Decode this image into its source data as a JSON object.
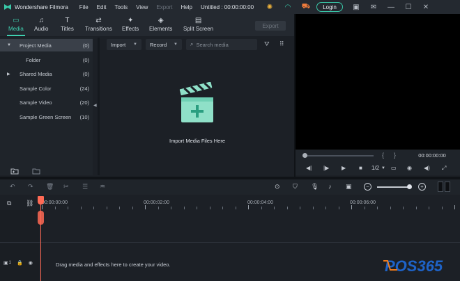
{
  "app": {
    "name": "Wondershare Filmora",
    "project_title": "Untitled : 00:00:00:00",
    "login_label": "Login"
  },
  "menu": [
    "File",
    "Edit",
    "Tools",
    "View",
    "Export",
    "Help"
  ],
  "tabs": [
    {
      "label": "Media",
      "icon": "folder-icon",
      "active": true
    },
    {
      "label": "Audio",
      "icon": "music-note-icon",
      "active": false
    },
    {
      "label": "Titles",
      "icon": "text-icon",
      "active": false
    },
    {
      "label": "Transitions",
      "icon": "transition-icon",
      "active": false
    },
    {
      "label": "Effects",
      "icon": "effects-icon",
      "active": false
    },
    {
      "label": "Elements",
      "icon": "elements-icon",
      "active": false
    },
    {
      "label": "Split Screen",
      "icon": "split-screen-icon",
      "active": false
    }
  ],
  "export_label": "Export",
  "library": [
    {
      "label": "Project Media",
      "count": "(0)",
      "selected": true,
      "expanded": true,
      "indent": 0
    },
    {
      "label": "Folder",
      "count": "(0)",
      "selected": false,
      "indent": 1
    },
    {
      "label": "Shared Media",
      "count": "(0)",
      "selected": false,
      "collapsed": true,
      "indent": 0
    },
    {
      "label": "Sample Color",
      "count": "(24)",
      "selected": false,
      "indent": 0
    },
    {
      "label": "Sample Video",
      "count": "(20)",
      "selected": false,
      "indent": 0
    },
    {
      "label": "Sample Green Screen",
      "count": "(10)",
      "selected": false,
      "indent": 0
    }
  ],
  "media": {
    "import_dropdown": "Import",
    "record_dropdown": "Record",
    "search_placeholder": "Search media",
    "import_hint": "Import Media Files Here"
  },
  "preview": {
    "timecode": "00:00:00:00",
    "playback_speed": "1/2"
  },
  "timeline": {
    "ruler_labels": [
      "00:00:00:00",
      "00:00:02:00",
      "00:00:04:00",
      "00:00:06:00"
    ],
    "drag_hint": "Drag media and effects here to create your video.",
    "track_number": "1"
  },
  "watermark": "POS365",
  "colors": {
    "accent": "#3fd0b0",
    "playhead": "#ff6a55",
    "bg": "#1c2026",
    "panel": "#242930",
    "watermark_blue": "#1e63c8",
    "watermark_orange": "#f07c1c"
  }
}
